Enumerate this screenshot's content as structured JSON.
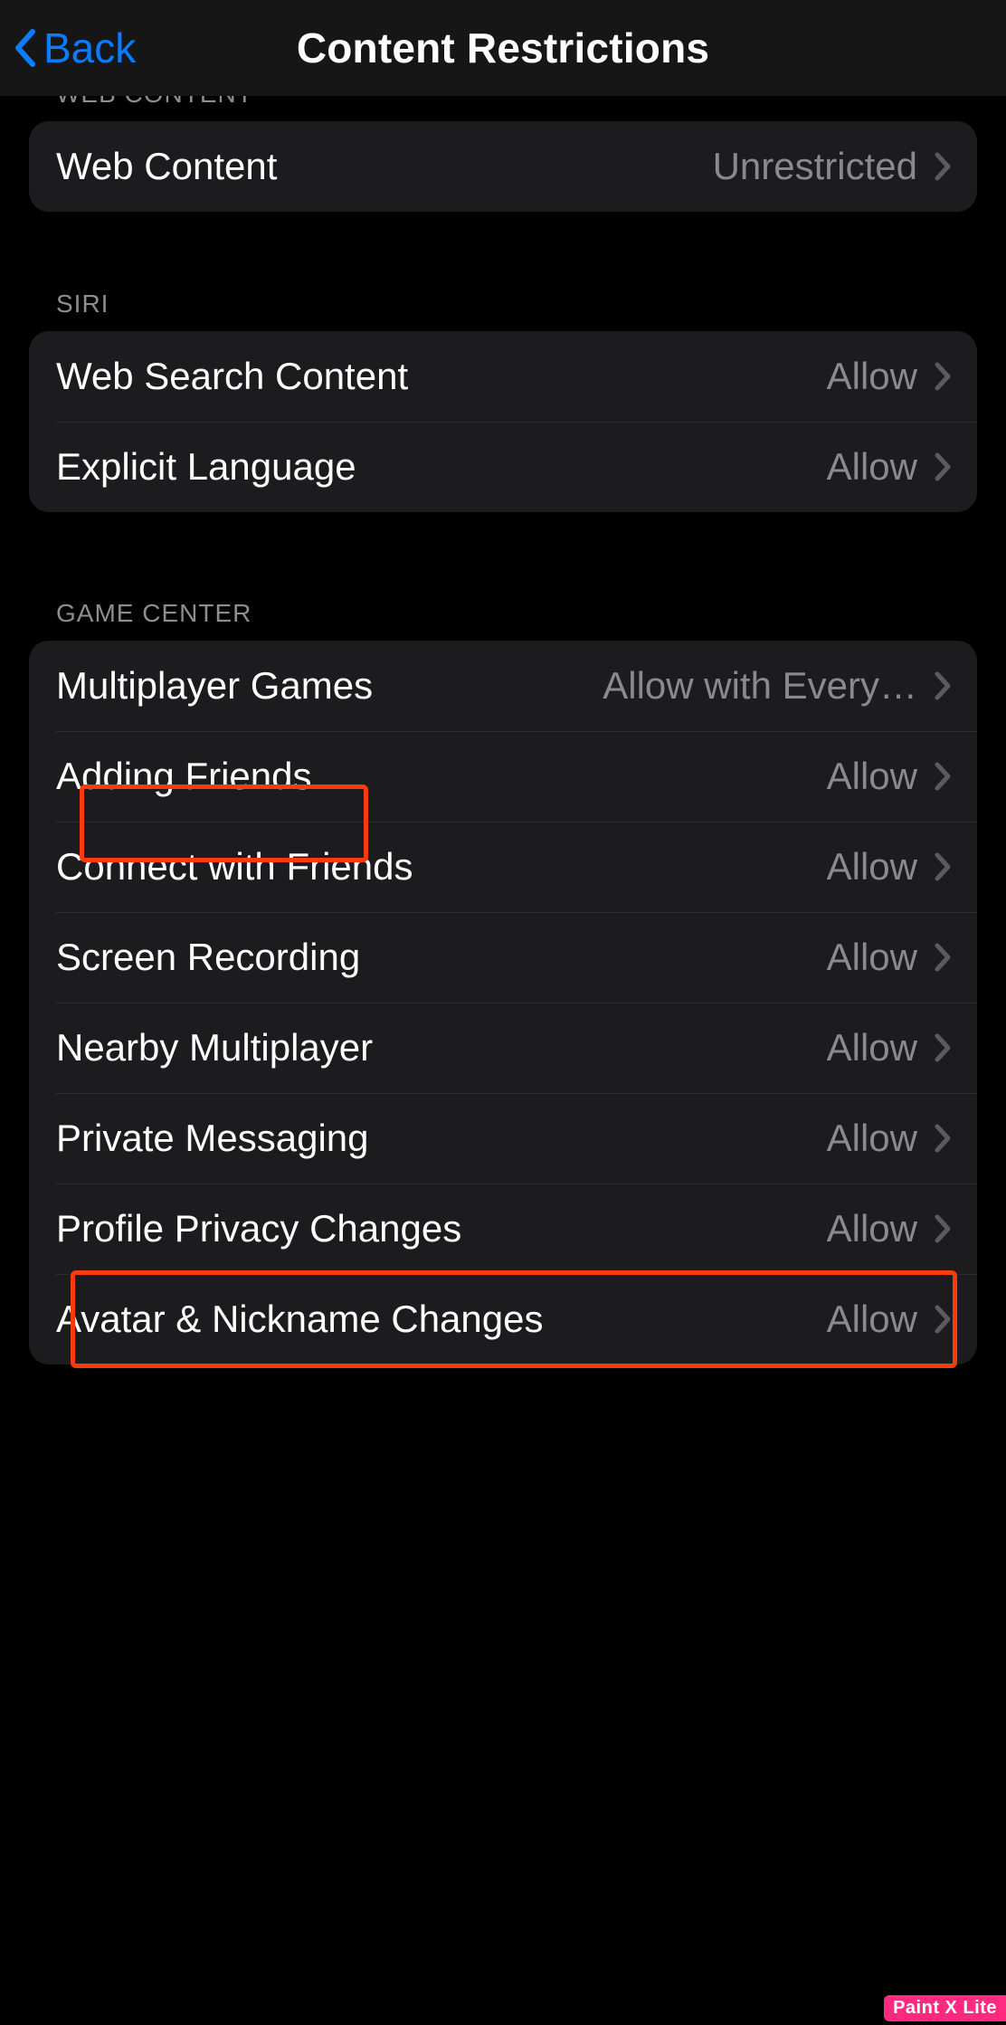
{
  "nav": {
    "back_label": "Back",
    "title": "Content Restrictions"
  },
  "sections": {
    "web_content": {
      "header": "WEB CONTENT",
      "items": [
        {
          "label": "Web Content",
          "value": "Unrestricted"
        }
      ]
    },
    "siri": {
      "header": "SIRI",
      "items": [
        {
          "label": "Web Search Content",
          "value": "Allow"
        },
        {
          "label": "Explicit Language",
          "value": "Allow"
        }
      ]
    },
    "game_center": {
      "header": "GAME CENTER",
      "items": [
        {
          "label": "Multiplayer Games",
          "value": "Allow with Every…"
        },
        {
          "label": "Adding Friends",
          "value": "Allow"
        },
        {
          "label": "Connect with Friends",
          "value": "Allow"
        },
        {
          "label": "Screen Recording",
          "value": "Allow"
        },
        {
          "label": "Nearby Multiplayer",
          "value": "Allow"
        },
        {
          "label": "Private Messaging",
          "value": "Allow"
        },
        {
          "label": "Profile Privacy Changes",
          "value": "Allow"
        },
        {
          "label": "Avatar & Nickname Changes",
          "value": "Allow"
        }
      ]
    }
  },
  "watermark": "Paint X Lite"
}
